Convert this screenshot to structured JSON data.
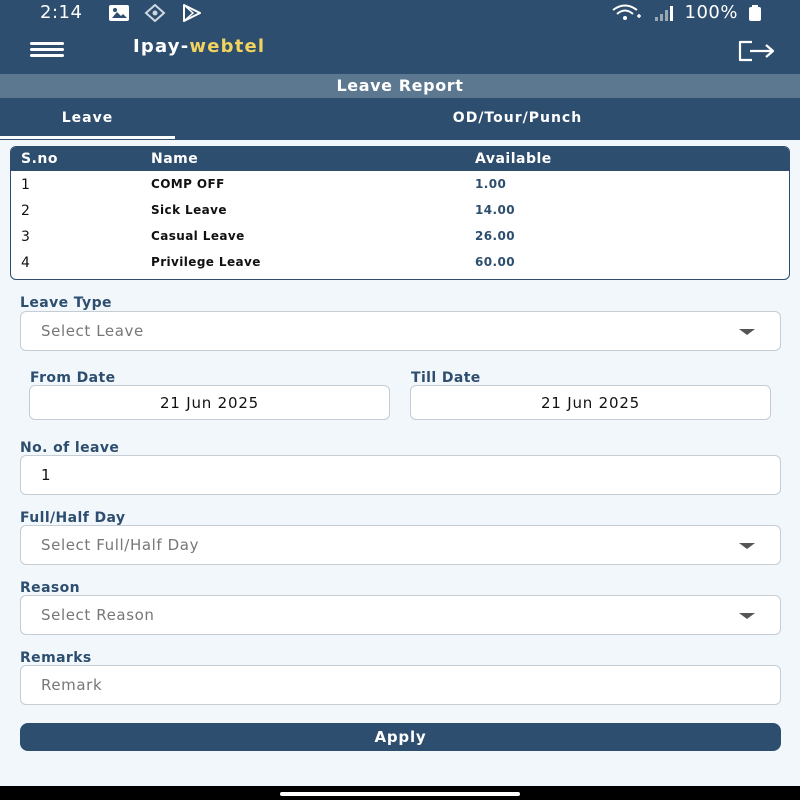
{
  "status_bar": {
    "time": "2:14",
    "battery": "100%",
    "icons": [
      "gallery-icon",
      "location-icon",
      "play-store-icon",
      "wifi-icon",
      "signal-icon",
      "battery-icon"
    ]
  },
  "app_bar": {
    "title_main": "Ipay-",
    "title_accent": "webtel",
    "colors": {
      "primary": "#2d4e6e",
      "accent": "#f2d35e"
    }
  },
  "report_title": "Leave Report",
  "tabs": [
    {
      "label": "Leave",
      "selected": true
    },
    {
      "label": "OD/Tour/Punch",
      "selected": false
    }
  ],
  "leave_table": {
    "headers": [
      "S.no",
      "Name",
      "Available"
    ],
    "rows": [
      {
        "sno": "1",
        "name": "COMP OFF",
        "available": "1.00"
      },
      {
        "sno": "2",
        "name": "Sick Leave",
        "available": "14.00"
      },
      {
        "sno": "3",
        "name": "Casual Leave",
        "available": "26.00"
      },
      {
        "sno": "4",
        "name": "Privilege Leave",
        "available": "60.00"
      }
    ]
  },
  "form": {
    "leave_type": {
      "label": "Leave Type",
      "placeholder": "Select Leave"
    },
    "from_date": {
      "label": "From Date",
      "value": "21 Jun 2025"
    },
    "till_date": {
      "label": "Till Date",
      "value": "21 Jun 2025"
    },
    "no_of_leave": {
      "label": "No. of leave",
      "value": "1"
    },
    "full_half": {
      "label": "Full/Half Day",
      "placeholder": "Select Full/Half Day"
    },
    "reason": {
      "label": "Reason",
      "placeholder": "Select Reason"
    },
    "remarks": {
      "label": "Remarks",
      "placeholder": "Remark"
    },
    "apply_label": "Apply"
  }
}
